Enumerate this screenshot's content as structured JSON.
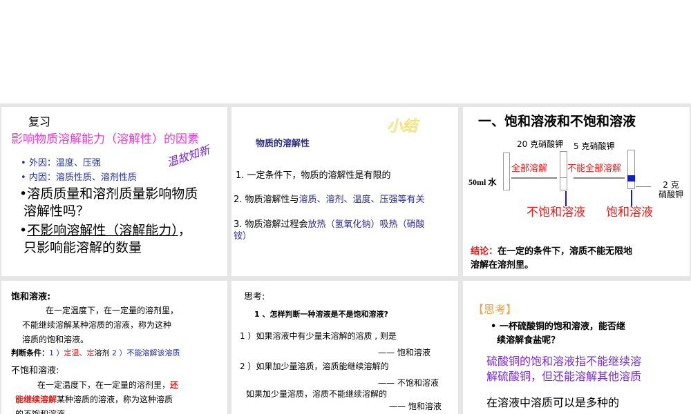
{
  "slides": [
    {
      "title": "复习",
      "subtitle": "影响物质溶解能力（溶解性）的因素",
      "stamp": "温故知新",
      "bullets": [
        "外因：温度、压强",
        "内因：溶质性质、溶剂性质"
      ],
      "q1": "溶质质量和溶剂质量影响物质",
      "q2": "溶解性吗？",
      "a1": "不影响溶解性（溶解能力）",
      "a1b": "，",
      "a2": "只影响能溶解的数量"
    },
    {
      "stamp": "小结",
      "heading": "物质的溶解性",
      "p1": "1. 一定条件下，物质的溶解性是有限的",
      "p2a": "2. 物质溶解性与",
      "p2b": "溶质、溶剂、温度、压强等有关",
      "p3a": "3. 物质溶解过程会",
      "p3b": "放热（氢氧化钠）吸热（硝酸",
      "p3c": "铵）"
    },
    {
      "title": "一、饱和溶液和不饱和溶液",
      "l20": "20 克硝酸钾",
      "l5": "5 克硝酸钾",
      "water": "50ml 水",
      "arrow1": "全部溶解",
      "arrow2": "不能全部溶解",
      "l2a": "2 克",
      "l2b": "硝酸钾",
      "unsat": "不饱和溶液",
      "sat": "饱和溶液",
      "concl_label": "结论：",
      "concl1": "在一定的条件下，溶质不能无限地",
      "concl2": "溶解在溶剂里。"
    },
    {
      "h1": "饱和溶液:",
      "d1": "在一定温度下，在一定量的溶剂里，",
      "d2": "不能继续溶解某种溶质的溶液，称为这种",
      "d3": "溶质的饱和溶液。",
      "cond_label": "判断条件：",
      "c1": "1 ）",
      "c2": "定温、定",
      "c3": "溶剂",
      "c4": "2 ）不能溶解该溶质",
      "h2": "不饱和溶液:",
      "e1": "在一定温度下，在一定量的溶剂里，",
      "e1r": "还",
      "e2r": "能继续溶解",
      "e2": "某种溶质的溶液，称为这种溶质",
      "e3": "的不饱和溶液。"
    },
    {
      "h": "思考:",
      "q": "1 、怎样判断一种溶液是不是饱和溶液?",
      "r1": "1 ）如果溶液中有少量未溶解的溶质 , 则是",
      "r1a": "—— 饱和溶液",
      "r2": "2 ）如果加少量溶质，溶质能继续溶解的",
      "r2a": "—— 不饱和溶液",
      "r3": "如果加少量溶质，溶质不能继续溶解的",
      "r3a": "—— 饱和溶液"
    },
    {
      "h": "【思考】",
      "b1": "一杯硫酸铜的饱和溶液，能否继",
      "b2": "续溶解食盐呢？",
      "p1": "硫酸铜的饱和溶液指不能继续溶",
      "p2": "解硫酸铜，但还能溶解其他溶质",
      "p3": "在溶液中溶质可以是多种的"
    }
  ]
}
